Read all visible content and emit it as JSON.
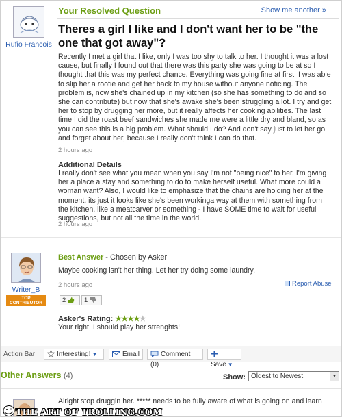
{
  "question": {
    "section_title": "Your Resolved Question",
    "show_more": "Show me another »",
    "asker_name": "Rufio Francois",
    "title": "Theres a girl I like and I don't want her to be \"the one that got away\"?",
    "body": "Recently I met a girl that I like, only I was too shy to talk to her. I thought it was a lost cause, but finally I found out that there was this party she was going to be at so I thought that this was my perfect chance. Everything was going fine at first, I was able to slip her a roofie and get her back to my house without anyone noticing. The problem is, now she's chained up in my kitchen (so she has something to do and so she can contribute) but now that she's awake she's been struggling a lot. I try and get her to stop by drugging her more, but it really affects her cooking abilities. The last time I did the roast beef sandwiches she made me were a little dry and bland, so as you can see this is a big problem. What should I do? And don't say just to let her go and forget about her, because I really don't think I can do that.",
    "time": "2 hours ago",
    "additional_title": "Additional Details",
    "additional_body": "I really don't see what you mean when you say I'm not \"being nice\" to her. I'm giving her a place a stay and something to do to make herself useful. What more could a woman want? Also, I would like to emphasize that the chains are holding her at the moment, its just it looks like she's been workinga way at them with something from the kitchen, like a meatcarver or something - I have SOME time to wait for useful suggestions, but not all the time in the world.",
    "additional_time": "2 hours ago"
  },
  "best_answer": {
    "label": "Best Answer",
    "chosen_by": " - Chosen by Asker",
    "answerer_name": "Writer_B",
    "badge": "TOP CONTRIBUTOR",
    "body": "Maybe cooking isn't her thing. Let her try doing some laundry.",
    "time": "2 hours ago",
    "report": "Report Abuse",
    "votes_up": "2",
    "votes_down": "1",
    "rating_label": "Asker's Rating:",
    "rating": 4,
    "rating_max": 5,
    "rating_comment": "Your right, I should play her strenghts!"
  },
  "action_bar": {
    "label": "Action Bar:",
    "interesting": "Interesting!",
    "email": "Email",
    "comment": "Comment (0)",
    "save": "Save"
  },
  "other_answers": {
    "title": "Other Answers",
    "count": "(4)",
    "show_label": "Show:",
    "sort_selected": "Oldest to Newest",
    "first_answer_preview": "Alright stop druggin her. ***** needs to be fully aware of what is going on and learn"
  },
  "watermark": "THE ART OF TROLLING.COM",
  "colors": {
    "accent_green": "#6c9e14",
    "link_blue": "#2a5db0",
    "badge_orange": "#e58a12"
  }
}
